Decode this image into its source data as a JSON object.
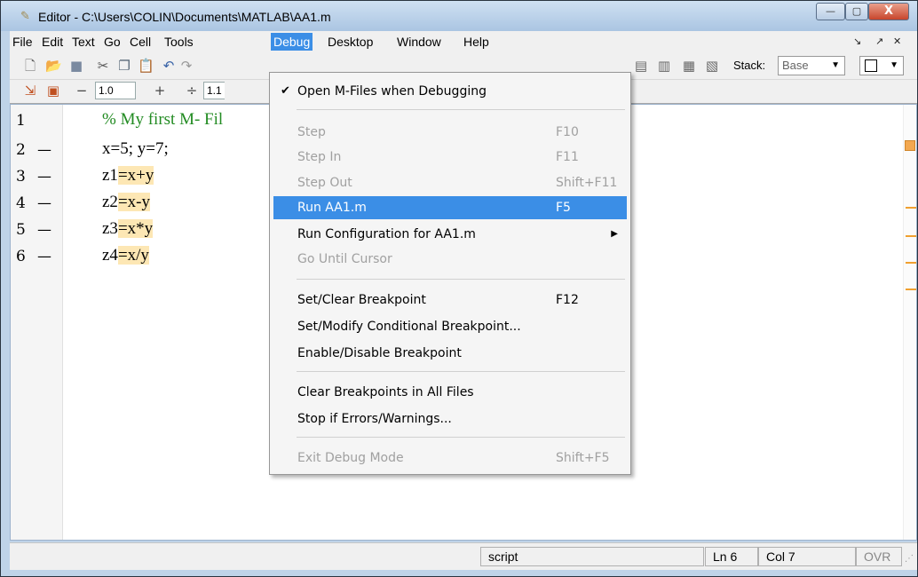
{
  "window": {
    "title": "Editor - C:\\Users\\COLIN\\Documents\\MATLAB\\AA1.m",
    "minimize_label": "—",
    "maximize_label": "▢",
    "close_label": "X"
  },
  "menubar": {
    "items": [
      "File",
      "Edit",
      "Text",
      "Go",
      "Cell",
      "Tools",
      "Debug",
      "Desktop",
      "Window",
      "Help"
    ],
    "active": "Debug",
    "right_controls": [
      "↘",
      "↗",
      "✕"
    ]
  },
  "toolbar2": {
    "minus_label": "−",
    "value1": "1.0",
    "plus_label": "+",
    "divide_label": "÷",
    "value2": "1.1"
  },
  "toolbar1": {
    "stack_label": "Stack:",
    "stack_value": "Base"
  },
  "editor": {
    "lines": [
      {
        "num": "1",
        "dash": "",
        "code": "% My first M- Fil",
        "comment": true
      },
      {
        "num": "2",
        "dash": "—",
        "code": "x=5; y=7;",
        "comment": false
      },
      {
        "num": "3",
        "dash": "—",
        "pre": "z1",
        "post": "=x+y"
      },
      {
        "num": "4",
        "dash": "—",
        "pre": "z2",
        "post": "=x-y"
      },
      {
        "num": "5",
        "dash": "—",
        "pre": "z3",
        "post": "=x*y"
      },
      {
        "num": "6",
        "dash": "—",
        "pre": "z4",
        "post": "=x/y"
      }
    ]
  },
  "debug_menu": {
    "items": [
      {
        "label": "Open M-Files when Debugging",
        "shortcut": "",
        "checked": true,
        "disabled": false
      },
      {
        "label": "Step",
        "shortcut": "F10",
        "disabled": true
      },
      {
        "label": "Step In",
        "shortcut": "F11",
        "disabled": true
      },
      {
        "label": "Step Out",
        "shortcut": "Shift+F11",
        "disabled": true
      },
      {
        "label": "Run AA1.m",
        "shortcut": "F5",
        "disabled": false,
        "highlight": true
      },
      {
        "label": "Run Configuration for AA1.m",
        "shortcut": "",
        "disabled": false,
        "submenu": true
      },
      {
        "label": "Go Until Cursor",
        "shortcut": "",
        "disabled": true
      },
      {
        "label": "Set/Clear Breakpoint",
        "shortcut": "F12",
        "disabled": false
      },
      {
        "label": "Set/Modify Conditional Breakpoint...",
        "shortcut": "",
        "disabled": false
      },
      {
        "label": "Enable/Disable Breakpoint",
        "shortcut": "",
        "disabled": false
      },
      {
        "label": "Clear Breakpoints in All Files",
        "shortcut": "",
        "disabled": false
      },
      {
        "label": "Stop if Errors/Warnings...",
        "shortcut": "",
        "disabled": false
      },
      {
        "label": "Exit Debug Mode",
        "shortcut": "Shift+F5",
        "disabled": true
      }
    ]
  },
  "statusbar": {
    "mode": "script",
    "ln": "Ln  6",
    "col": "Col  7",
    "ovr": "OVR"
  }
}
